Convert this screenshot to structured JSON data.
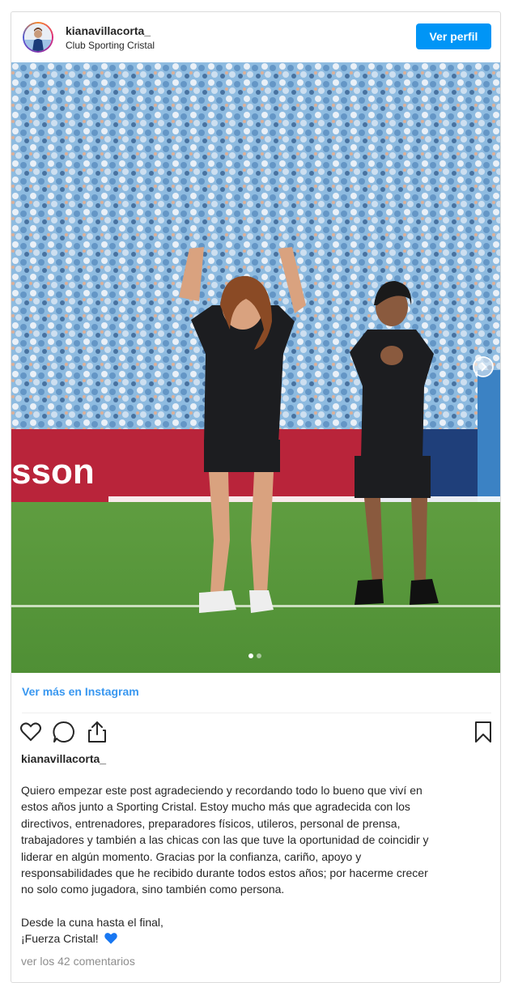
{
  "header": {
    "username": "kianavillacorta_",
    "location": "Club Sporting Cristal",
    "view_profile_label": "Ver perfil"
  },
  "media": {
    "banner_text": "sson",
    "carousel_dots": 2,
    "active_dot": 1
  },
  "see_more_label": "Ver más en Instagram",
  "actions": {
    "like_icon": "heart-icon",
    "comment_icon": "comment-icon",
    "share_icon": "share-icon",
    "save_icon": "bookmark-icon"
  },
  "post_username": "kianavillacorta_",
  "caption": {
    "lines": [
      "Quiero empezar este post agradeciendo y recordando todo lo bueno que viví en",
      "estos años junto a Sporting Cristal. Estoy mucho más que agradecida con los",
      "directivos, entrenadores, preparadores físicos, utileros, personal de prensa,",
      "trabajadores y también a las chicas con las que tuve la oportunidad de coincidir y",
      "liderar en algún momento. Gracias por la confianza, cariño, apoyo y",
      "responsabilidades que he recibido durante todos estos años; por hacerme crecer",
      "no solo como jugadora, sino también como persona."
    ],
    "closing_1": "Desde la cuna hasta el final,",
    "closing_2": "¡Fuerza Cristal!",
    "emoji": "blue-heart"
  },
  "comments_link": "ver los 42 comentarios",
  "colors": {
    "accent": "#0095f6",
    "link": "#3897f0",
    "heart": "#1877f2"
  }
}
